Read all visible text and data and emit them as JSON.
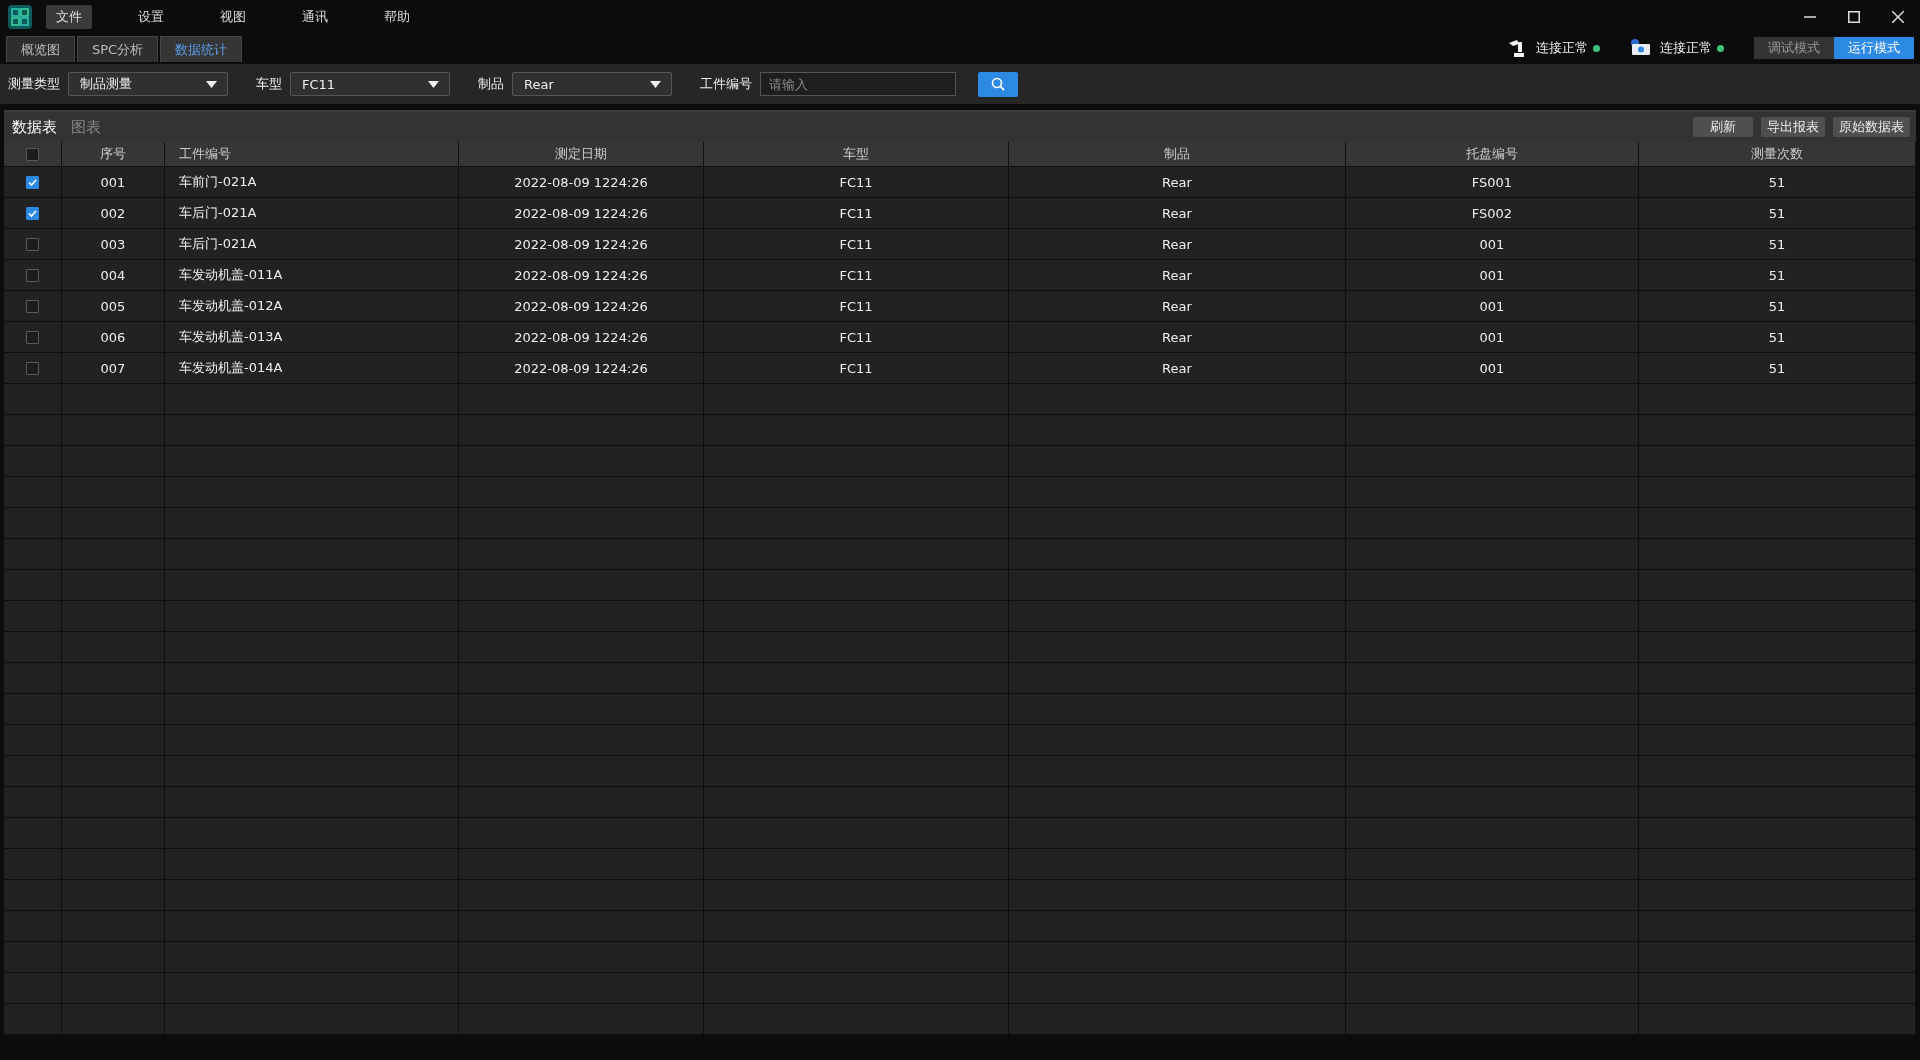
{
  "menu": [
    {
      "label": "文件",
      "selected": true
    },
    {
      "label": "设置",
      "selected": false
    },
    {
      "label": "视图",
      "selected": false
    },
    {
      "label": "通讯",
      "selected": false
    },
    {
      "label": "帮助",
      "selected": false
    }
  ],
  "tabs": [
    {
      "label": "概览图",
      "selected": false
    },
    {
      "label": "SPC分析",
      "selected": false
    },
    {
      "label": "数据统计",
      "selected": true
    }
  ],
  "status": [
    {
      "kind": "robot",
      "label": "连接正常",
      "color": "#3ec27e"
    },
    {
      "kind": "camera",
      "label": "连接正常",
      "color": "#3ec27e"
    }
  ],
  "modes": [
    {
      "label": "调试模式",
      "selected": false
    },
    {
      "label": "运行模式",
      "selected": true
    }
  ],
  "filters": [
    {
      "kind": "select",
      "label": "测量类型",
      "value": "制品测量"
    },
    {
      "kind": "select",
      "label": "车型",
      "value": "FC11"
    },
    {
      "kind": "select",
      "label": "制品",
      "value": "Rear"
    },
    {
      "kind": "input",
      "label": "工件编号",
      "placeholder": "请输入"
    }
  ],
  "view_tabs": [
    {
      "label": "数据表",
      "selected": true
    },
    {
      "label": "图表",
      "selected": false
    }
  ],
  "actions": [
    "刷新",
    "导出报表",
    "原始数据表"
  ],
  "table": {
    "header_checked": false,
    "columns": [
      "序号",
      "工件编号",
      "测定日期",
      "车型",
      "制品",
      "托盘编号",
      "测量次数"
    ],
    "rows": [
      {
        "checked": true,
        "cells": [
          "001",
          "车前门-021A",
          "2022-08-09 1224:26",
          "FC11",
          "Rear",
          "FS001",
          "51"
        ]
      },
      {
        "checked": true,
        "cells": [
          "002",
          "车后门-021A",
          "2022-08-09 1224:26",
          "FC11",
          "Rear",
          "FS002",
          "51"
        ]
      },
      {
        "checked": false,
        "cells": [
          "003",
          "车后门-021A",
          "2022-08-09 1224:26",
          "FC11",
          "Rear",
          "001",
          "51"
        ]
      },
      {
        "checked": false,
        "cells": [
          "004",
          "车发动机盖-011A",
          "2022-08-09 1224:26",
          "FC11",
          "Rear",
          "001",
          "51"
        ]
      },
      {
        "checked": false,
        "cells": [
          "005",
          "车发动机盖-012A",
          "2022-08-09 1224:26",
          "FC11",
          "Rear",
          "001",
          "51"
        ]
      },
      {
        "checked": false,
        "cells": [
          "006",
          "车发动机盖-013A",
          "2022-08-09 1224:26",
          "FC11",
          "Rear",
          "001",
          "51"
        ]
      },
      {
        "checked": false,
        "cells": [
          "007",
          "车发动机盖-014A",
          "2022-08-09 1224:26",
          "FC11",
          "Rear",
          "001",
          "51"
        ]
      }
    ]
  }
}
